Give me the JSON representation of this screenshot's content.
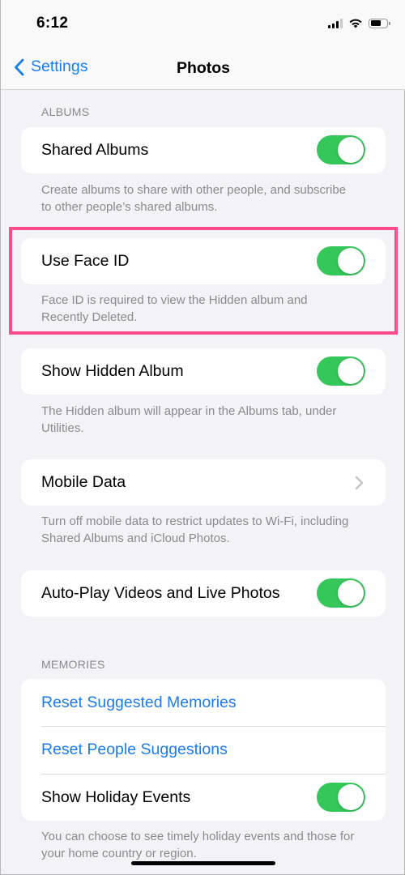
{
  "status_bar": {
    "time": "6:12",
    "icons": [
      "cellular-signal-icon",
      "wifi-icon",
      "battery-icon"
    ]
  },
  "nav": {
    "back_label": "Settings",
    "back_icon": "chevron-left-icon",
    "title": "Photos"
  },
  "colors": {
    "accent": "#1a7cf5",
    "toggle_on": "#34c759",
    "highlight": "#ff4a8b",
    "background": "#f2f2f7"
  },
  "sections": {
    "albums": {
      "header": "ALBUMS",
      "shared_albums": {
        "label": "Shared Albums",
        "on": true,
        "footer": "Create albums to share with other people, and subscribe to other people’s shared albums."
      },
      "use_face_id": {
        "label": "Use Face ID",
        "on": true,
        "footer": "Face ID is required to view the Hidden album and Recently Deleted."
      },
      "show_hidden_album": {
        "label": "Show Hidden Album",
        "on": true,
        "footer": "The Hidden album will appear in the Albums tab, under Utilities."
      },
      "mobile_data": {
        "label": "Mobile Data",
        "footer": "Turn off mobile data to restrict updates to Wi-Fi, including Shared Albums and iCloud Photos."
      },
      "auto_play": {
        "label": "Auto-Play Videos and Live Photos",
        "on": true
      }
    },
    "memories": {
      "header": "MEMORIES",
      "reset_suggested_memories": "Reset Suggested Memories",
      "reset_people_suggestions": "Reset People Suggestions",
      "show_holiday_events": {
        "label": "Show Holiday Events",
        "on": true
      },
      "footer": "You can choose to see timely holiday events and those for your home country or region."
    }
  }
}
